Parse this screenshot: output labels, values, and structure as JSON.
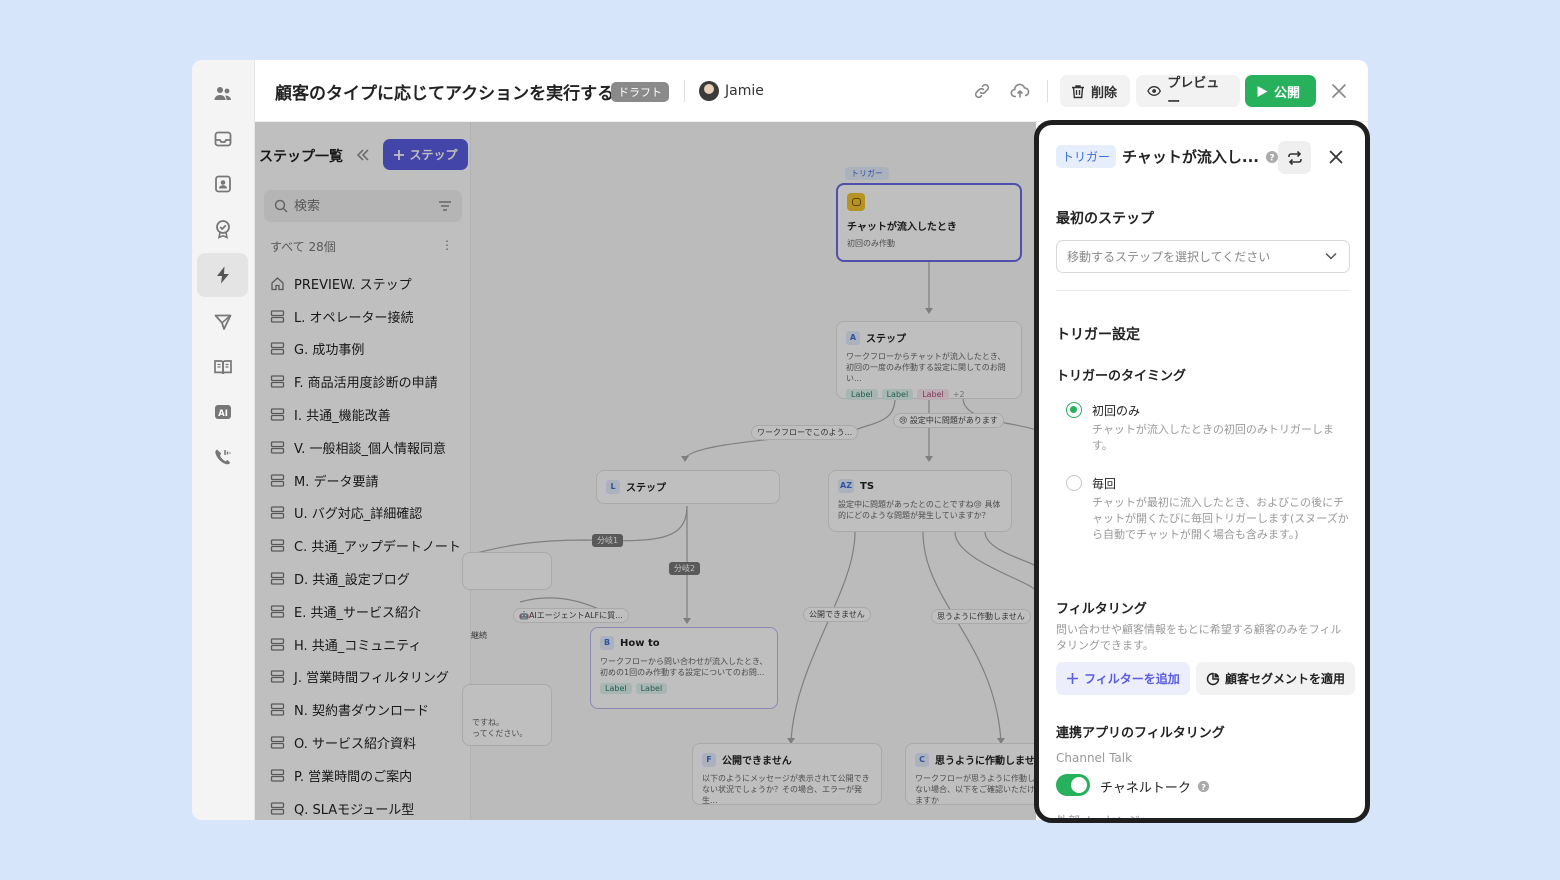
{
  "header": {
    "title": "顧客のタイプに応じてアクションを実行する",
    "status_badge": "ドラフト",
    "user_name": "Jamie",
    "delete_label": "削除",
    "preview_label": "プレビュー",
    "publish_label": "公開"
  },
  "sidebar": {
    "icons": [
      "people-icon",
      "inbox-icon",
      "contacts-icon",
      "badge-check-icon",
      "workflow-bolt-icon",
      "send-icon",
      "book-icon",
      "ai-icon",
      "phone-icon"
    ],
    "active": "workflow-bolt-icon"
  },
  "steplist": {
    "title": "ステップ一覧",
    "add_label": "ステップ",
    "search_placeholder": "検索",
    "count": "すべて 28個",
    "items": [
      "PREVIEW. ステップ",
      "L. オペレーター接続",
      "G. 成功事例",
      "F. 商品活用度診断の申請",
      "I. 共通_機能改善",
      "V. 一般相談_個人情報同意",
      "M. データ要請",
      "U. バグ対応_詳細確認",
      "C. 共通_アップデートノート",
      "D. 共通_設定ブログ",
      "E. 共通_サービス紹介",
      "H. 共通_コミュニティ",
      "J. 営業時間フィルタリング",
      "N. 契約書ダウンロード",
      "O. サービス紹介資料",
      "P. 営業時間のご案内",
      "Q. SLAモジュール型"
    ]
  },
  "canvas": {
    "trigger_tag": "トリガー",
    "trigger_node": {
      "title": "チャットが流入したとき",
      "sub": "初回のみ作動"
    },
    "node_a": {
      "letter": "A",
      "title": "ステップ",
      "body": "ワークフローからチャットが流入したとき、初回の一度のみ作動する設定に関してのお問い...",
      "labels": [
        "Label",
        "Label",
        "Label"
      ],
      "more": "+2"
    },
    "edge_1": "ワークフローでこのよう...",
    "edge_2": "😢 設定中に問題があります",
    "node_l": {
      "letter": "L",
      "title": "ステップ"
    },
    "node_az": {
      "letter": "AZ",
      "title": "TS",
      "body": "設定中に問題があったとのことですね😢 具体的にどのような問題が発生していますか？"
    },
    "branch_1": "分岐1",
    "branch_2": "分岐2",
    "edge_ai": "🤖AIエージェントALFに質...",
    "edge_cannot_publish": "公開できません",
    "edge_not_working": "思うように作動しません",
    "edge_partial": "継続",
    "node_b": {
      "letter": "B",
      "title": "How to",
      "body": "ワークフローから問い合わせが流入したとき、初めの1回のみ作動する設定についてのお問...",
      "labels": [
        "Label",
        "Label"
      ]
    },
    "node_f": {
      "letter": "F",
      "title": "公開できません",
      "body": "以下のようにメッセージが表示されて公開できない状況でしょうか？その場合、エラーが発生..."
    },
    "node_c": {
      "letter": "C",
      "title": "思うように作動しません",
      "body": "ワークフローが思うように作動しない場合、以下をご確認いただけますか"
    },
    "node_partial": {
      "body": "ですね。\nってください。"
    }
  },
  "panel": {
    "trigger_tag": "トリガー",
    "title": "チャットが流入し...",
    "first_step_heading": "最初のステップ",
    "first_step_placeholder": "移動するステップを選択してください",
    "trigger_settings_heading": "トリガー設定",
    "timing_heading": "トリガーのタイミング",
    "timing_options": [
      {
        "label": "初回のみ",
        "desc": "チャットが流入したときの初回のみトリガーします。",
        "selected": true
      },
      {
        "label": "毎回",
        "desc": "チャットが最初に流入したとき、およびこの後にチャットが開くたびに毎回トリガーします(スヌーズから自動でチャットが開く場合も含みます。)",
        "selected": false
      }
    ],
    "filtering_heading": "フィルタリング",
    "filtering_desc": "問い合わせや顧客情報をもとに希望する顧客のみをフィルタリングできます。",
    "add_filter_label": "フィルターを追加",
    "segment_label": "顧客セグメントを適用",
    "app_filtering_heading": "連携アプリのフィルタリング",
    "channel_talk_sub": "Channel Talk",
    "channel_toggle_label": "チャネルトーク",
    "channel_toggle_on": true,
    "next_sub": "外部メッセンジャー"
  },
  "colors": {
    "accent": "#5b5ce0",
    "publish": "#27b15c",
    "background": "#d7e5fb"
  }
}
